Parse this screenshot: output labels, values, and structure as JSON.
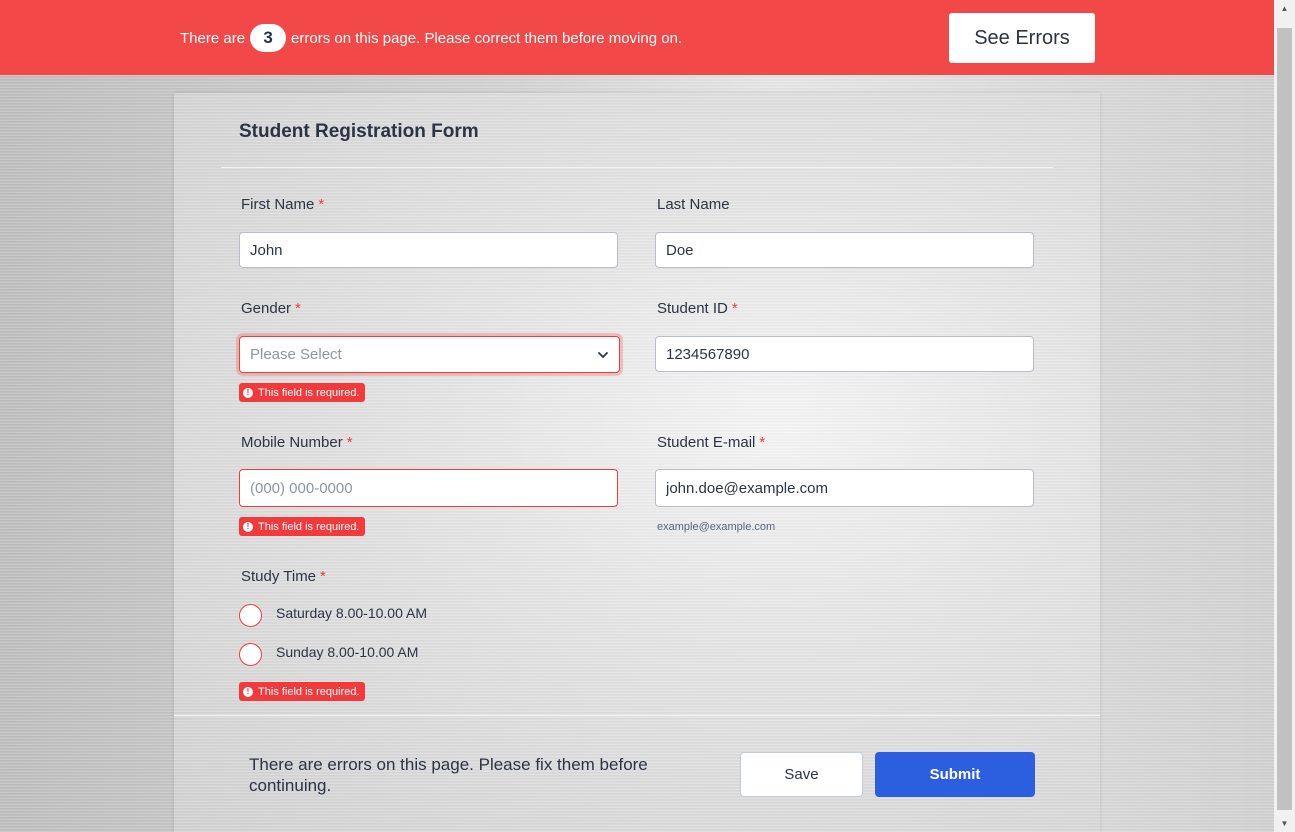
{
  "banner": {
    "text_before": "There are",
    "error_count": "3",
    "text_after": "errors on this page. Please correct them before moving on.",
    "see_errors_label": "See Errors"
  },
  "form": {
    "title": "Student Registration Form",
    "required_marker": "*",
    "error_message": "This field is required.",
    "first_name": {
      "label": "First Name",
      "value": "John"
    },
    "last_name": {
      "label": "Last Name",
      "value": "Doe"
    },
    "gender": {
      "label": "Gender",
      "placeholder": "Please Select"
    },
    "student_id": {
      "label": "Student ID",
      "value": "1234567890"
    },
    "mobile": {
      "label": "Mobile Number",
      "placeholder": "(000) 000-0000"
    },
    "email": {
      "label": "Student E-mail",
      "value": "john.doe@example.com",
      "sublabel": "example@example.com"
    },
    "study_time": {
      "label": "Study Time",
      "options": [
        "Saturday 8.00-10.00 AM",
        "Sunday 8.00-10.00 AM"
      ]
    }
  },
  "footer": {
    "message": "There are errors on this page. Please fix them before continuing.",
    "save_label": "Save",
    "submit_label": "Submit"
  },
  "colors": {
    "banner": "#f34848",
    "error": "#f23a3c",
    "primary": "#2b5fe0",
    "text": "#2c3345"
  },
  "icons": [
    "alert-icon",
    "chevron-down-icon",
    "scroll-up-arrow-icon",
    "scroll-down-arrow-icon"
  ]
}
